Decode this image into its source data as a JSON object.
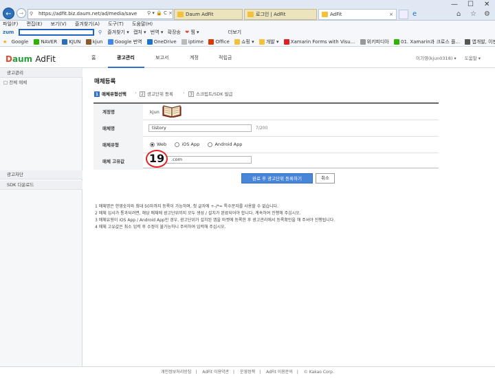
{
  "browser": {
    "url": "https://adfit.biz.daum.net/ad/media/save",
    "tabs": [
      {
        "label": "Daum AdFit",
        "active": false
      },
      {
        "label": "로그인 | AdFit",
        "active": false
      },
      {
        "label": "AdFit",
        "active": true
      }
    ],
    "menu": [
      "파일(F)",
      "편집(E)",
      "보기(V)",
      "즐겨찾기(A)",
      "도구(T)",
      "도움말(H)"
    ],
    "toolbar": {
      "search_brand": "zum",
      "items": [
        "즐겨찾기",
        "캡처",
        "번역",
        "확장송",
        "찜",
        "더보기"
      ]
    },
    "favorites": [
      "Google",
      "NAVER",
      "KJUN",
      "kjun",
      "Google 번역",
      "OneDrive",
      "iptime",
      "Office",
      "쇼핑",
      "개발",
      "Xamarin Forms with Visu...",
      "위키피디아",
      "01. Xamarin과 크로스 플...",
      "앱개발, 이젠 다시 크로스..."
    ]
  },
  "site": {
    "logo_d": "D",
    "logo_m": "aum",
    "logo_product": "AdFit",
    "nav": [
      {
        "label": "홈",
        "active": false
      },
      {
        "label": "광고관리",
        "active": true
      },
      {
        "label": "보고서",
        "active": false
      },
      {
        "label": "계정",
        "active": false
      },
      {
        "label": "적립금",
        "active": false
      }
    ],
    "user": "이기영(kjun0318) ▾",
    "help": "도움말 ▾"
  },
  "sidebar": {
    "section1": "광고관리",
    "item1": "전체 매체",
    "section2": "광고차단",
    "section3": "SDK 다운로드"
  },
  "content": {
    "title": "매체등록",
    "steps": [
      {
        "num": "1",
        "label": "매체유형선택",
        "active": true
      },
      {
        "num": "2",
        "label": "광고단위 등록",
        "active": false
      },
      {
        "num": "3",
        "label": "스크립트/SDK 발급",
        "active": false
      }
    ],
    "form": {
      "account_label": "계정명",
      "account_value": "kjun",
      "media_name_label": "매체명",
      "media_name_value": "tistory",
      "media_name_count": "7/200",
      "media_type_label": "매체유형",
      "media_type_options": [
        "Web",
        "iOS App",
        "Android App"
      ],
      "media_type_selected": "Web",
      "unique_label": "매체 고유값",
      "unique_value": ".com"
    },
    "annotation_number": "19",
    "submit_label": "완료 후 광고단위 등록하기",
    "cancel_label": "취소",
    "notes": [
      "1  매체명은 한영숫자와 최대 50자까지 등록이 가능하며, 첫 글자에 +-/*= 특수문자를 사용할 수 없습니다.",
      "2  매체 심사가 통과되려면, 해당 매체에 광고단위까지 모두 생성 / 설치가 완료되어야 합니다. 계속하여 진행해 주십시오.",
      "3  매체유형이 iOS App / Android App인 경우, 광고단위가 설치된 앱을 마켓에 등록한 후 광고관리에서 등록확인을 해 주셔야 진행됩니다.",
      "4  매체 고유값은 최소 입력 후 수정이 불가능하니 주의하여 입력해 주십시오."
    ]
  },
  "footer": [
    "개인정보처리방침",
    "AdFit 이용약관",
    "운영정책",
    "AdFit 이용문의",
    "© Kakao Corp."
  ]
}
